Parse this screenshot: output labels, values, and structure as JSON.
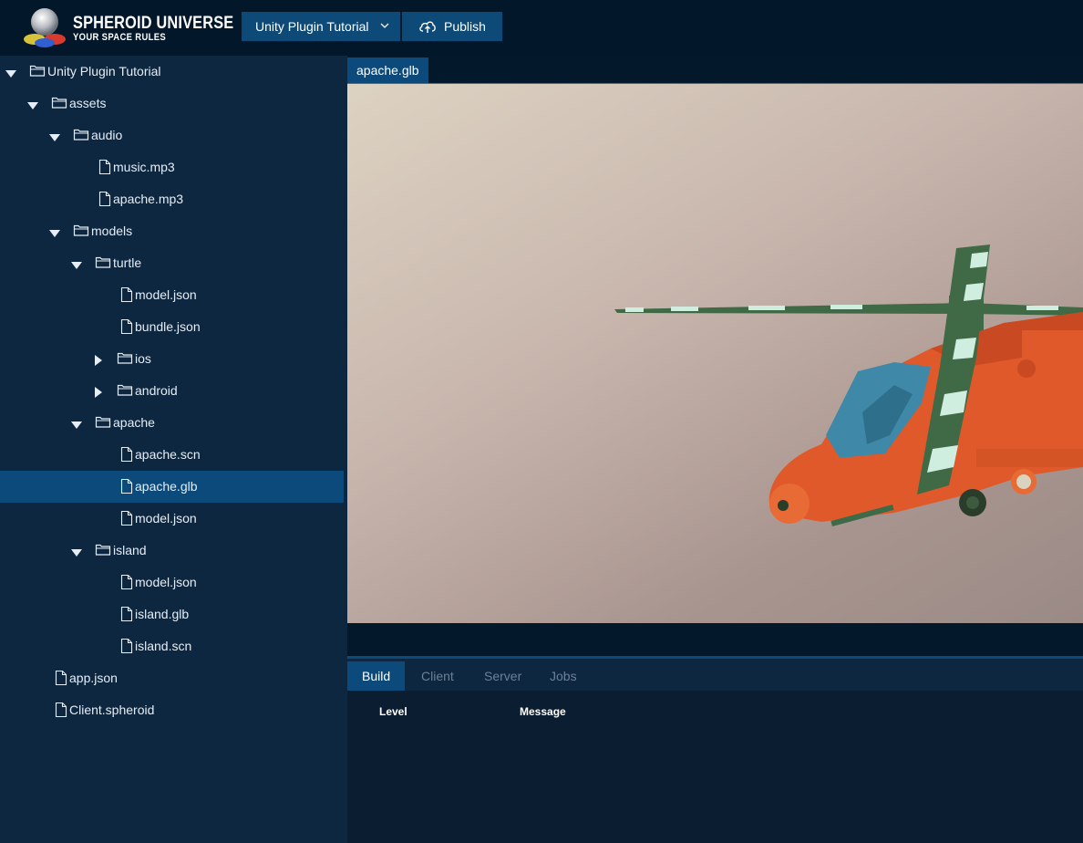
{
  "header": {
    "logo_title": "SPHEROID UNIVERSE",
    "logo_tagline": "YOUR SPACE RULES",
    "project_selector": "Unity Plugin Tutorial",
    "publish_label": "Publish"
  },
  "tree": [
    {
      "label": "Unity Plugin Tutorial",
      "type": "folder",
      "depth": 0,
      "expanded": true
    },
    {
      "label": "assets",
      "type": "folder",
      "depth": 1,
      "expanded": true
    },
    {
      "label": "audio",
      "type": "folder",
      "depth": 2,
      "expanded": true
    },
    {
      "label": "music.mp3",
      "type": "file",
      "depth": 3
    },
    {
      "label": "apache.mp3",
      "type": "file",
      "depth": 3
    },
    {
      "label": "models",
      "type": "folder",
      "depth": 2,
      "expanded": true
    },
    {
      "label": "turtle",
      "type": "folder",
      "depth": 3,
      "expanded": true
    },
    {
      "label": "model.json",
      "type": "file",
      "depth": 4
    },
    {
      "label": "bundle.json",
      "type": "file",
      "depth": 4
    },
    {
      "label": "ios",
      "type": "folder",
      "depth": 4,
      "expanded": false
    },
    {
      "label": "android",
      "type": "folder",
      "depth": 4,
      "expanded": false
    },
    {
      "label": "apache",
      "type": "folder",
      "depth": 3,
      "expanded": true
    },
    {
      "label": "apache.scn",
      "type": "file",
      "depth": 4
    },
    {
      "label": "apache.glb",
      "type": "file",
      "depth": 4,
      "selected": true
    },
    {
      "label": "model.json",
      "type": "file",
      "depth": 4
    },
    {
      "label": "island",
      "type": "folder",
      "depth": 3,
      "expanded": true
    },
    {
      "label": "model.json",
      "type": "file",
      "depth": 4
    },
    {
      "label": "island.glb",
      "type": "file",
      "depth": 4
    },
    {
      "label": "island.scn",
      "type": "file",
      "depth": 4
    },
    {
      "label": "app.json",
      "type": "file",
      "depth": 1
    },
    {
      "label": "Client.spheroid",
      "type": "file",
      "depth": 1
    }
  ],
  "editor": {
    "active_tab": "apache.glb"
  },
  "bottom_panel": {
    "tabs": [
      "Build",
      "Client",
      "Server",
      "Jobs"
    ],
    "active_tab": "Build",
    "columns": {
      "level": "Level",
      "message": "Message"
    }
  }
}
